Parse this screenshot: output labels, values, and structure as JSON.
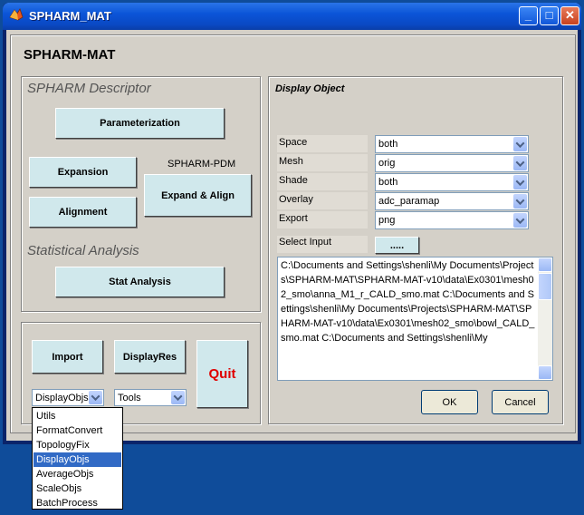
{
  "window": {
    "title": "SPHARM_MAT",
    "controls": {
      "minimize": "_",
      "maximize": "□",
      "close": "✕"
    }
  },
  "app": {
    "heading": "SPHARM-MAT"
  },
  "descriptor_panel": {
    "title": "SPHARM Descriptor",
    "parameterization": "Parameterization",
    "expansion": "Expansion",
    "alignment": "Alignment",
    "pdm_label": "SPHARM-PDM",
    "expand_align": "Expand & Align",
    "stat_title": "Statistical Analysis",
    "stat_analysis": "Stat Analysis"
  },
  "bottom_panel": {
    "import": "Import",
    "displayres": "DisplayRes",
    "quit": "Quit",
    "utils_selected": "DisplayObjs",
    "tools_selected": "Tools",
    "utils_options": [
      "Utils",
      "FormatConvert",
      "TopologyFix",
      "DisplayObjs",
      "AverageObjs",
      "ScaleObjs",
      "BatchProcess"
    ],
    "utils_highlighted_index": 3
  },
  "display_panel": {
    "title": "Display Object",
    "params": [
      {
        "label": "Space",
        "value": "both"
      },
      {
        "label": "Mesh",
        "value": "orig"
      },
      {
        "label": "Shade",
        "value": "both"
      },
      {
        "label": "Overlay",
        "value": "adc_paramap"
      },
      {
        "label": "Export",
        "value": "png"
      }
    ],
    "select_input_label": "Select Input",
    "browse_label": ".....",
    "input_list": "C:\\Documents and Settings\\shenli\\My Documents\\Projects\\SPHARM-MAT\\SPHARM-MAT-v10\\data\\Ex0301\\mesh02_smo\\anna_M1_r_CALD_smo.mat C:\\Documents and Settings\\shenli\\My Documents\\Projects\\SPHARM-MAT\\SPHARM-MAT-v10\\data\\Ex0301\\mesh02_smo\\bowl_CALD_smo.mat C:\\Documents and Settings\\shenli\\My",
    "ok": "OK",
    "cancel": "Cancel"
  },
  "colors": {
    "desktop": "#0f4c9a",
    "window_face": "#d4d0c8",
    "button_face": "#d0e8ec",
    "quit_text": "#e00000",
    "highlight": "#316ac5"
  },
  "icons": {
    "app": "matlab-icon",
    "dropdown": "chevron-down-icon"
  }
}
